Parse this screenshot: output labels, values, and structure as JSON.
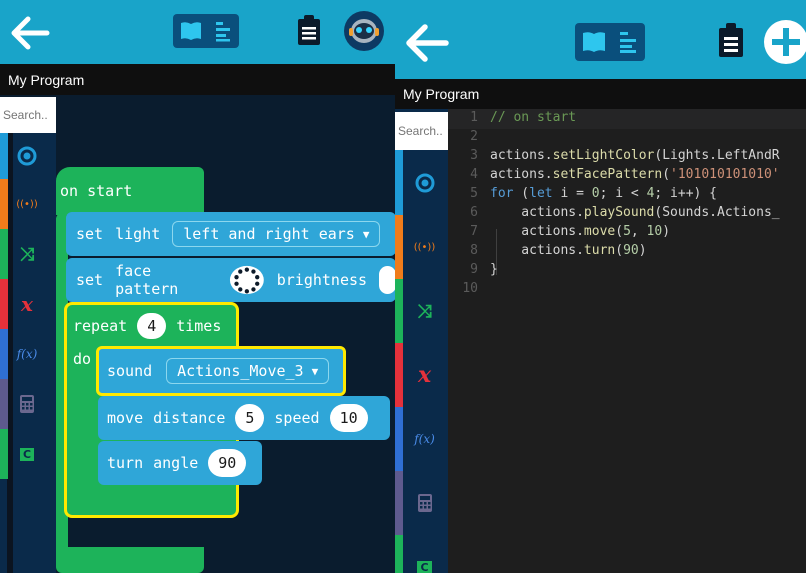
{
  "colors": {
    "header": "#19a4c9",
    "toggle": "#0a4f7c",
    "workspace": "#0a1c2e",
    "loops_block": "#1db35a",
    "action_block": "#2fa6d8",
    "highlight": "#ffe900",
    "editor_bg": "#1e1e1e"
  },
  "left": {
    "header": {
      "back_icon": "arrow-left-icon",
      "toggle_icons": [
        "book-icon",
        "text-lines-icon"
      ],
      "clipboard_icon": "clipboard-icon",
      "avatar_icon": "robot-avatar-icon"
    },
    "title": "My Program",
    "search_placeholder": "Search..",
    "categories": [
      {
        "name": "events",
        "glyph": "◎",
        "color": "#1f9bd7"
      },
      {
        "name": "sound",
        "glyph": "((•))",
        "color": "#f07c1b"
      },
      {
        "name": "loops",
        "glyph": "⤨",
        "color": "#1db35a"
      },
      {
        "name": "variables",
        "glyph": "𝒙",
        "color": "#e5313b"
      },
      {
        "name": "functions",
        "glyph": "𝑓(x)",
        "color": "#2f6fd4"
      },
      {
        "name": "math",
        "glyph": "▦",
        "color": "#5e5a8e"
      },
      {
        "name": "custom",
        "glyph": "C",
        "color": "#1db35a"
      }
    ],
    "blocks": {
      "on_start": "on start",
      "set_light": {
        "keyword": "set",
        "param": "light",
        "value": "left and right ears"
      },
      "set_face": {
        "keyword": "set",
        "param1": "face pattern",
        "param2": "brightness"
      },
      "repeat": {
        "keyword": "repeat",
        "count": "4",
        "suffix": "times",
        "do": "do"
      },
      "sound": {
        "keyword": "sound",
        "value": "Actions_Move_3"
      },
      "move": {
        "keyword": "move",
        "param1": "distance",
        "value1": "5",
        "param2": "speed",
        "value2": "10"
      },
      "turn": {
        "keyword": "turn",
        "param": "angle",
        "value": "90"
      }
    }
  },
  "right": {
    "header": {
      "back_icon": "arrow-left-icon",
      "toggle_icons": [
        "book-icon",
        "text-lines-icon"
      ],
      "clipboard_icon": "clipboard-icon",
      "add_icon": "plus-circle-icon"
    },
    "title": "My Program",
    "search_placeholder": "Search..",
    "code": {
      "line_numbers": [
        "1",
        "2",
        "3",
        "4",
        "5",
        "6",
        "7",
        "8",
        "9",
        "10"
      ],
      "lines": [
        "// on start",
        "",
        "actions.setLightColor(Lights.LeftAndR",
        "actions.setFacePattern('101010101010'",
        "for (let i = 0; i < 4; i++) {",
        "    actions.playSound(Sounds.Actions_",
        "    actions.move(5, 10)",
        "    actions.turn(90)",
        "}",
        ""
      ]
    }
  }
}
